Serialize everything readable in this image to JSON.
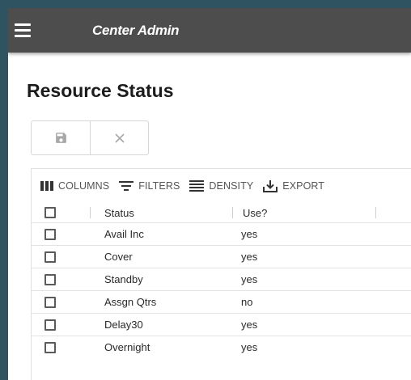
{
  "appbar": {
    "title": "Center Admin"
  },
  "page": {
    "title": "Resource Status"
  },
  "toolbar": {
    "columns_label": "COLUMNS",
    "filters_label": "FILTERS",
    "density_label": "DENSITY",
    "export_label": "EXPORT"
  },
  "grid": {
    "headers": {
      "status": "Status",
      "use": "Use?"
    },
    "rows": [
      {
        "status": "Avail Inc",
        "use": "yes"
      },
      {
        "status": "Cover",
        "use": "yes"
      },
      {
        "status": "Standby",
        "use": "yes"
      },
      {
        "status": "Assgn Qtrs",
        "use": "no"
      },
      {
        "status": "Delay30",
        "use": "yes"
      },
      {
        "status": "Overnight",
        "use": "yes"
      }
    ]
  },
  "colors": {
    "appbar": "#4d4d4d",
    "border_frame": "#2f5360",
    "icon_disabled": "#a8a8a8",
    "toolbar_icon": "#333333"
  },
  "icons": {
    "menu": "hamburger-icon",
    "save": "save-icon",
    "cancel": "close-icon",
    "columns": "columns-icon",
    "filters": "filter-icon",
    "density": "density-icon",
    "export": "export-icon"
  }
}
